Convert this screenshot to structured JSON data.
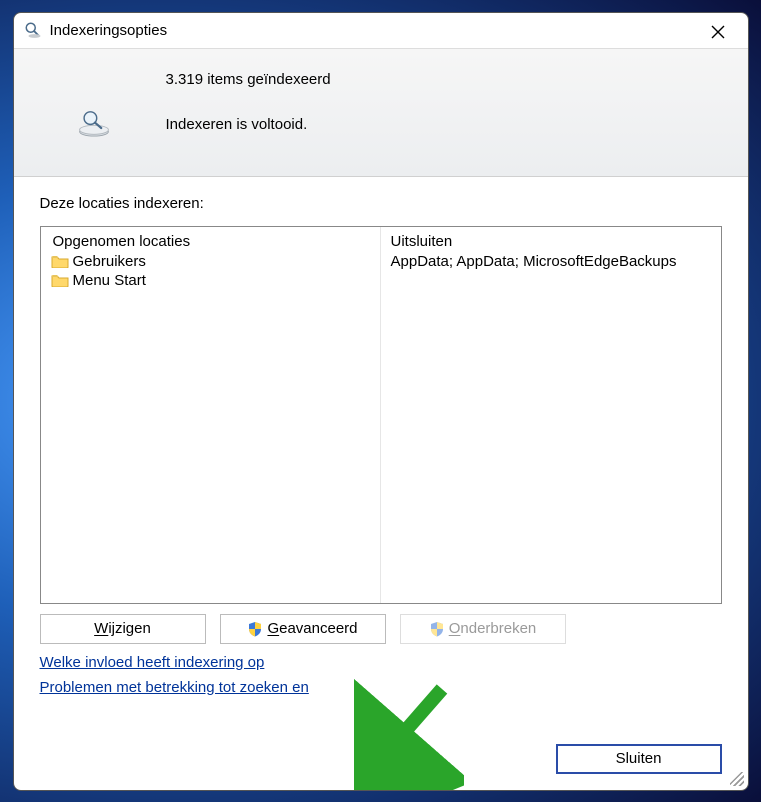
{
  "window": {
    "title": "Indexeringsopties"
  },
  "status": {
    "indexed_line": "3.319 items geïndexeerd",
    "status_text": "Indexeren is voltooid."
  },
  "locations": {
    "label": "Deze locaties indexeren:",
    "included_header": "Opgenomen locaties",
    "exclude_header": "Uitsluiten",
    "included": [
      {
        "label": "Gebruikers"
      },
      {
        "label": "Menu Start"
      }
    ],
    "exclude_text": "AppData; AppData; MicrosoftEdgeBackups"
  },
  "buttons": {
    "modify": "Wijzigen",
    "advanced": "Geavanceerd",
    "pause": "Onderbreken",
    "close": "Sluiten"
  },
  "links": {
    "help1": "Welke invloed heeft indexering op",
    "help2": "Problemen met betrekking tot zoeken en"
  }
}
